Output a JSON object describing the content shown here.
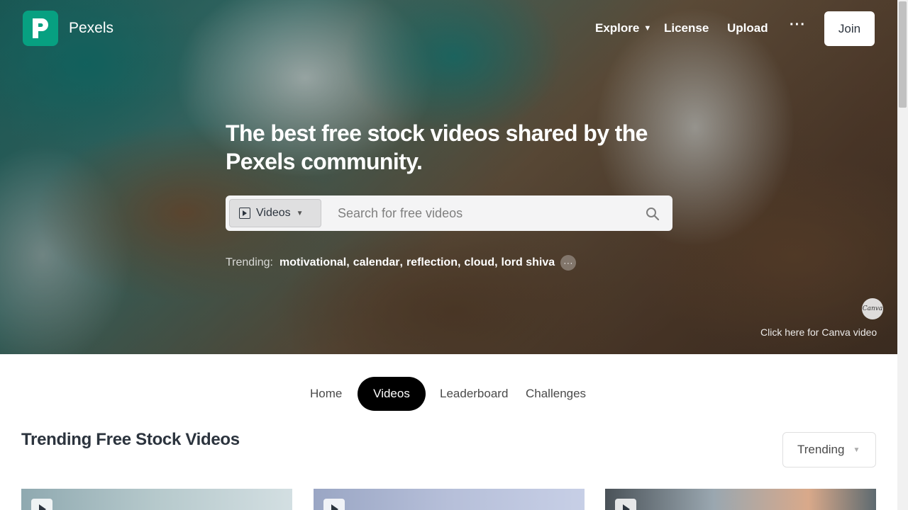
{
  "nav": {
    "brand": "Pexels",
    "explore": "Explore",
    "license": "License",
    "upload": "Upload",
    "more": "···",
    "join": "Join"
  },
  "hero": {
    "title": "The best free stock videos shared by the Pexels community.",
    "search": {
      "type_label": "Videos",
      "placeholder": "Search for free videos"
    },
    "trending": {
      "label": "Trending:",
      "tags": [
        "motivational",
        "calendar",
        "reflection",
        "cloud",
        "lord shiva"
      ],
      "more": "···"
    },
    "canva_badge": "Canva",
    "canva_link": "Click here for Canva video"
  },
  "tabs": {
    "home": "Home",
    "videos": "Videos",
    "leaderboard": "Leaderboard",
    "challenges": "Challenges"
  },
  "section": {
    "title": "Trending Free Stock Videos",
    "sort": "Trending"
  },
  "colors": {
    "brand": "#07a081",
    "active_tab": "#000000",
    "text": "#2c343e"
  },
  "icons": [
    "pexels-logo-icon",
    "chevron-down-icon",
    "more-icon",
    "video-type-icon",
    "search-icon",
    "play-icon"
  ]
}
